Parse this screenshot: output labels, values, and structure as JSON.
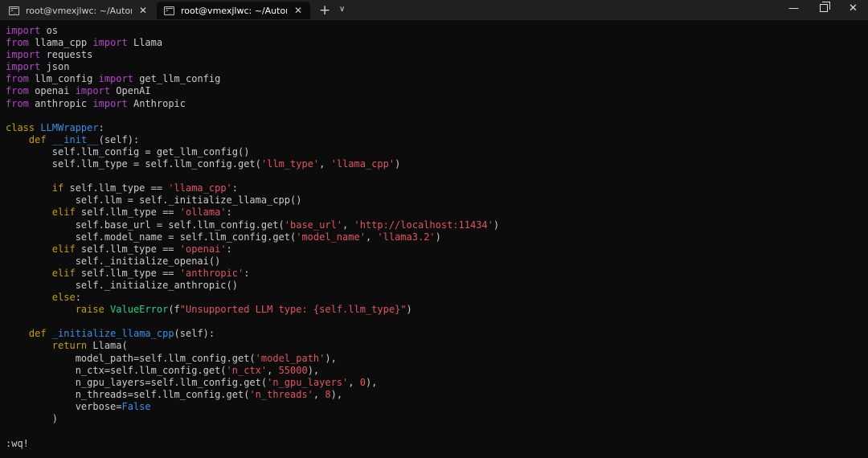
{
  "tabs": [
    {
      "label": "root@vmexjlwc: ~/Automated",
      "icon": "terminal-icon"
    },
    {
      "label": "root@vmexjlwc: ~/Automated",
      "icon": "terminal-icon"
    }
  ],
  "window": {
    "new_tab": "+",
    "dropdown": "∨",
    "minimize": "—",
    "close": "✕"
  },
  "code": [
    [
      [
        "kw",
        "import"
      ],
      [
        "plain",
        " os"
      ]
    ],
    [
      [
        "kw",
        "from"
      ],
      [
        "plain",
        " llama_cpp "
      ],
      [
        "kw",
        "import"
      ],
      [
        "plain",
        " Llama"
      ]
    ],
    [
      [
        "kw",
        "import"
      ],
      [
        "plain",
        " requests"
      ]
    ],
    [
      [
        "kw",
        "import"
      ],
      [
        "plain",
        " json"
      ]
    ],
    [
      [
        "kw",
        "from"
      ],
      [
        "plain",
        " llm_config "
      ],
      [
        "kw",
        "import"
      ],
      [
        "plain",
        " get_llm_config"
      ]
    ],
    [
      [
        "kw",
        "from"
      ],
      [
        "plain",
        " openai "
      ],
      [
        "kw",
        "import"
      ],
      [
        "plain",
        " OpenAI"
      ]
    ],
    [
      [
        "kw",
        "from"
      ],
      [
        "plain",
        " anthropic "
      ],
      [
        "kw",
        "import"
      ],
      [
        "plain",
        " Anthropic"
      ]
    ],
    [],
    [
      [
        "kw2",
        "class"
      ],
      [
        "plain",
        " "
      ],
      [
        "cls",
        "LLMWrapper"
      ],
      [
        "plain",
        ":"
      ]
    ],
    [
      [
        "plain",
        "    "
      ],
      [
        "kw2",
        "def"
      ],
      [
        "plain",
        " "
      ],
      [
        "fn",
        "__init__"
      ],
      [
        "plain",
        "(self):"
      ]
    ],
    [
      [
        "plain",
        "        self.llm_config = get_llm_config()"
      ]
    ],
    [
      [
        "plain",
        "        self.llm_type = self.llm_config.get("
      ],
      [
        "str",
        "'llm_type'"
      ],
      [
        "plain",
        ", "
      ],
      [
        "str",
        "'llama_cpp'"
      ],
      [
        "plain",
        ")"
      ]
    ],
    [],
    [
      [
        "plain",
        "        "
      ],
      [
        "kw2",
        "if"
      ],
      [
        "plain",
        " self.llm_type == "
      ],
      [
        "str",
        "'llama_cpp'"
      ],
      [
        "plain",
        ":"
      ]
    ],
    [
      [
        "plain",
        "            self.llm = self._initialize_llama_cpp()"
      ]
    ],
    [
      [
        "plain",
        "        "
      ],
      [
        "kw2",
        "elif"
      ],
      [
        "plain",
        " self.llm_type == "
      ],
      [
        "str",
        "'ollama'"
      ],
      [
        "plain",
        ":"
      ]
    ],
    [
      [
        "plain",
        "            self.base_url = self.llm_config.get("
      ],
      [
        "str",
        "'base_url'"
      ],
      [
        "plain",
        ", "
      ],
      [
        "str",
        "'http://localhost:11434'"
      ],
      [
        "plain",
        ")"
      ]
    ],
    [
      [
        "plain",
        "            self.model_name = self.llm_config.get("
      ],
      [
        "str",
        "'model_name'"
      ],
      [
        "plain",
        ", "
      ],
      [
        "str",
        "'llama3.2'"
      ],
      [
        "plain",
        ")"
      ]
    ],
    [
      [
        "plain",
        "        "
      ],
      [
        "kw2",
        "elif"
      ],
      [
        "plain",
        " self.llm_type == "
      ],
      [
        "str",
        "'openai'"
      ],
      [
        "plain",
        ":"
      ]
    ],
    [
      [
        "plain",
        "            self._initialize_openai()"
      ]
    ],
    [
      [
        "plain",
        "        "
      ],
      [
        "kw2",
        "elif"
      ],
      [
        "plain",
        " self.llm_type == "
      ],
      [
        "str",
        "'anthropic'"
      ],
      [
        "plain",
        ":"
      ]
    ],
    [
      [
        "plain",
        "            self._initialize_anthropic()"
      ]
    ],
    [
      [
        "plain",
        "        "
      ],
      [
        "kw2",
        "else"
      ],
      [
        "plain",
        ":"
      ]
    ],
    [
      [
        "plain",
        "            "
      ],
      [
        "kw2",
        "raise"
      ],
      [
        "plain",
        " "
      ],
      [
        "err",
        "ValueError"
      ],
      [
        "plain",
        "(f"
      ],
      [
        "str",
        "\"Unsupported LLM type: {self.llm_type}\""
      ],
      [
        "plain",
        ")"
      ]
    ],
    [],
    [
      [
        "plain",
        "    "
      ],
      [
        "kw2",
        "def"
      ],
      [
        "plain",
        " "
      ],
      [
        "fn",
        "_initialize_llama_cpp"
      ],
      [
        "plain",
        "(self):"
      ]
    ],
    [
      [
        "plain",
        "        "
      ],
      [
        "kw2",
        "return"
      ],
      [
        "plain",
        " Llama("
      ]
    ],
    [
      [
        "plain",
        "            model_path=self.llm_config.get("
      ],
      [
        "str",
        "'model_path'"
      ],
      [
        "plain",
        "),"
      ]
    ],
    [
      [
        "plain",
        "            n_ctx=self.llm_config.get("
      ],
      [
        "str",
        "'n_ctx'"
      ],
      [
        "plain",
        ", "
      ],
      [
        "num",
        "55000"
      ],
      [
        "plain",
        "),"
      ]
    ],
    [
      [
        "plain",
        "            n_gpu_layers=self.llm_config.get("
      ],
      [
        "str",
        "'n_gpu_layers'"
      ],
      [
        "plain",
        ", "
      ],
      [
        "num",
        "0"
      ],
      [
        "plain",
        "),"
      ]
    ],
    [
      [
        "plain",
        "            n_threads=self.llm_config.get("
      ],
      [
        "str",
        "'n_threads'"
      ],
      [
        "plain",
        ", "
      ],
      [
        "num",
        "8"
      ],
      [
        "plain",
        "),"
      ]
    ],
    [
      [
        "plain",
        "            verbose="
      ],
      [
        "bool",
        "False"
      ]
    ],
    [
      [
        "plain",
        "        )"
      ]
    ]
  ],
  "command_line": ":wq!"
}
